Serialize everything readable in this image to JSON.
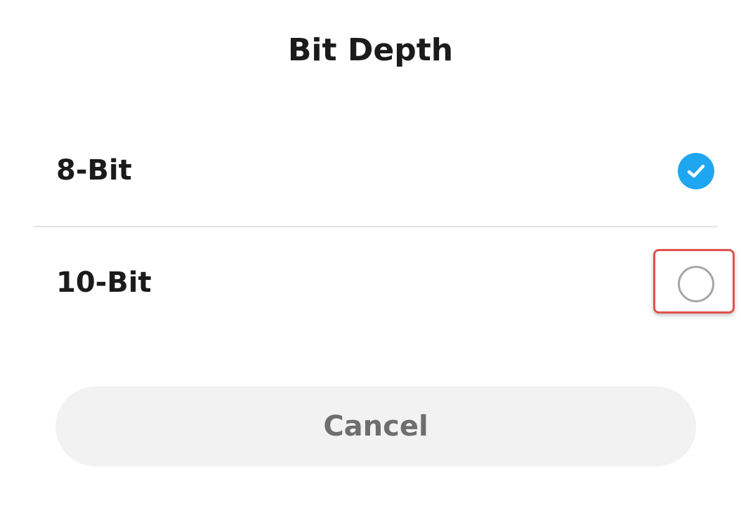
{
  "sheet": {
    "title": "Bit Depth"
  },
  "options": [
    {
      "label": "8-Bit",
      "selected": true
    },
    {
      "label": "10-Bit",
      "selected": false
    }
  ],
  "cancel_label": "Cancel",
  "colors": {
    "selected_accent": "#1fa6f0",
    "unselected_ring": "#a6a6a6",
    "highlight_outline": "#e0524d",
    "cancel_background": "#f2f2f2",
    "cancel_text": "#6e6e6e"
  },
  "icons": {
    "selected": "check-circle-icon",
    "unselected": "radio-empty-icon"
  }
}
